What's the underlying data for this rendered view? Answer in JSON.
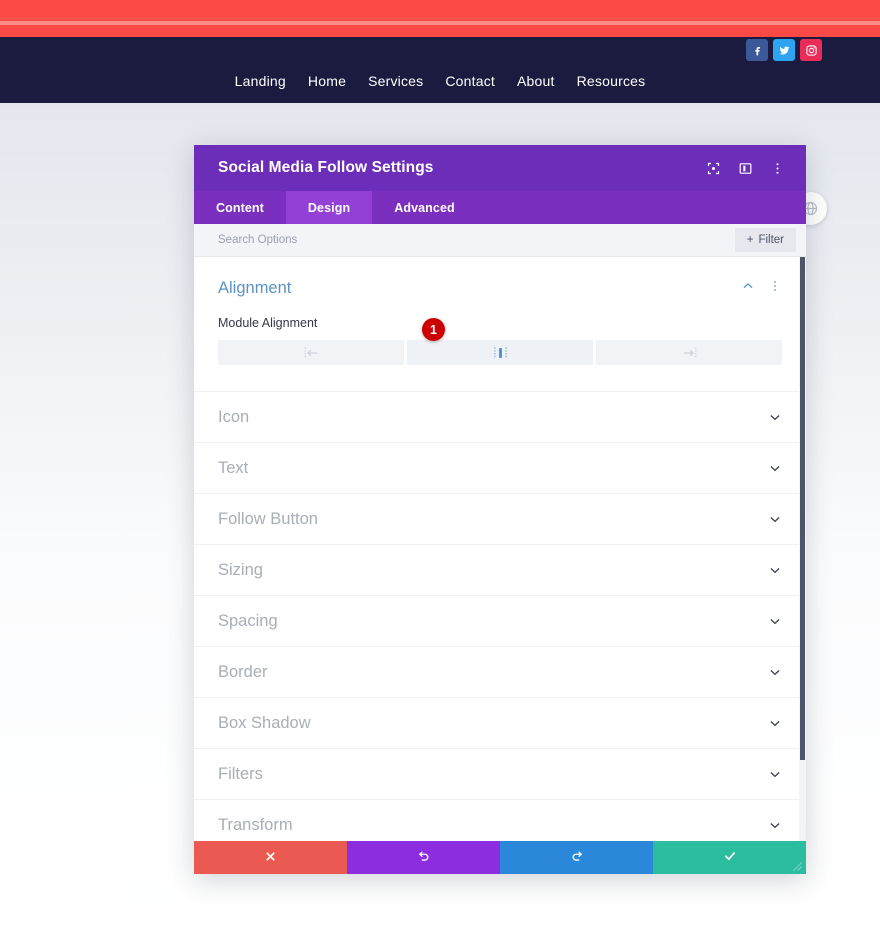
{
  "site_header": {
    "nav_items": [
      {
        "label": "Landing"
      },
      {
        "label": "Home"
      },
      {
        "label": "Services"
      },
      {
        "label": "Contact"
      },
      {
        "label": "About"
      },
      {
        "label": "Resources"
      }
    ],
    "social_icons": [
      {
        "name": "facebook-icon",
        "color": "#3b5998"
      },
      {
        "name": "twitter-icon",
        "color": "#2ea3f2"
      },
      {
        "name": "instagram-icon",
        "color": "#ea2c59"
      }
    ],
    "banner_color": "#fb4a45",
    "nav_background": "#1b1b3f"
  },
  "modal": {
    "title": "Social Media Follow Settings",
    "header_color": "#6c2eb9",
    "header_icons": [
      {
        "name": "focus-target-icon"
      },
      {
        "name": "layout-panel-icon"
      },
      {
        "name": "more-vertical-icon"
      }
    ],
    "tabs": [
      {
        "label": "Content",
        "active": false
      },
      {
        "label": "Design",
        "active": true
      },
      {
        "label": "Advanced",
        "active": false
      }
    ],
    "search": {
      "value": "",
      "placeholder": "Search Options"
    },
    "filter_button": {
      "label": "Filter",
      "plus": "+"
    },
    "alignment_section": {
      "title": "Alignment",
      "collapse_icon": "chevron-up-icon",
      "menu_icon": "more-vertical-icon",
      "field_label": "Module Alignment",
      "options": [
        {
          "name": "align-left",
          "active": false
        },
        {
          "name": "align-center",
          "active": true
        },
        {
          "name": "align-right",
          "active": false
        }
      ]
    },
    "sections": [
      {
        "label": "Icon"
      },
      {
        "label": "Text"
      },
      {
        "label": "Follow Button"
      },
      {
        "label": "Sizing"
      },
      {
        "label": "Spacing"
      },
      {
        "label": "Border"
      },
      {
        "label": "Box Shadow"
      },
      {
        "label": "Filters"
      },
      {
        "label": "Transform"
      }
    ],
    "footer_buttons": [
      {
        "name": "cancel-button",
        "icon": "close-icon",
        "color": "#eb5a52"
      },
      {
        "name": "undo-button",
        "icon": "undo-icon",
        "color": "#8c2ee0"
      },
      {
        "name": "redo-button",
        "icon": "redo-icon",
        "color": "#2b87da"
      },
      {
        "name": "save-button",
        "icon": "check-icon",
        "color": "#2bbd9d"
      }
    ]
  },
  "annotations": {
    "badge_1": "1"
  },
  "floating": {
    "globe_icon": "globe-icon"
  }
}
